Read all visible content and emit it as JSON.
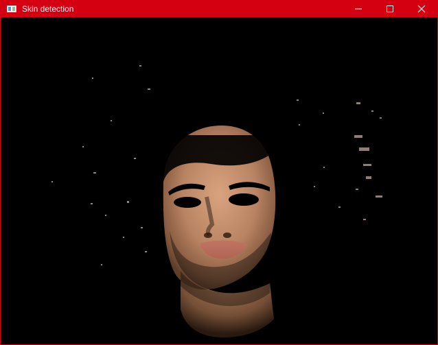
{
  "window": {
    "title": "Skin detection",
    "accent_color": "#d40012",
    "icons": {
      "app": "app-window-icon",
      "minimize": "minimize-icon",
      "maximize": "maximize-icon",
      "close": "close-icon"
    }
  }
}
